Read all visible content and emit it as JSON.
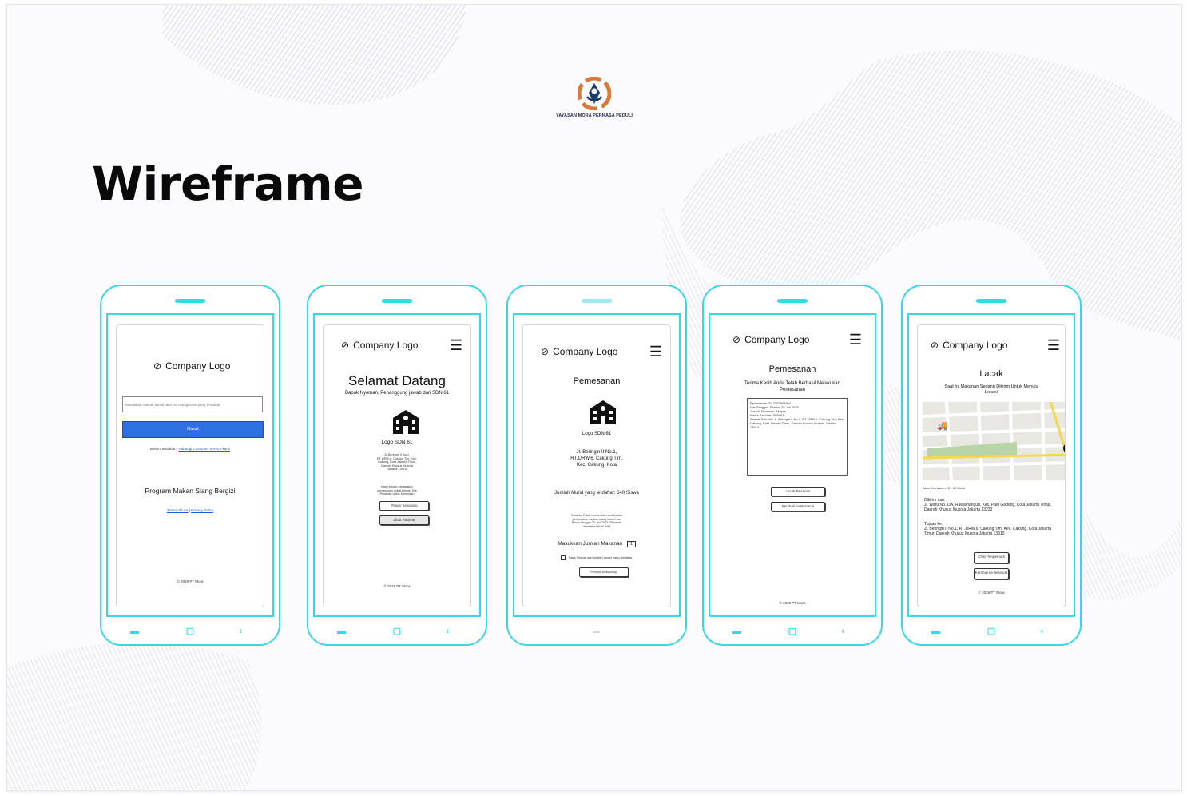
{
  "brand": {
    "name": "YAYASAN MORA PERKASA PEDULI"
  },
  "slide": {
    "title": "Wireframe"
  },
  "accent_color": "#39d6e6",
  "phones": {
    "login": {
      "logo_text": "Company Logo",
      "input_placeholder": "Masukkan Alamat Email atau No Handphone yang terdaftar",
      "submit_label": "Masuk",
      "signup_prompt": "Belum Terdaftar?",
      "signup_link": "Hubungi Customer Service kami",
      "program_title": "Program Makan Siang Bergizi",
      "terms_link": "Terms of Use",
      "separator": "|",
      "privacy_link": "Privacy Policy",
      "footer": "© 2025 PT Mora"
    },
    "welcome": {
      "logo_text": "Company Logo",
      "title": "Selamat Datang",
      "subtitle": "Bapak Nyoman,  Penanggung jawab dari SDN 61",
      "school_label": "Logo SDN 61",
      "address": "Jl. Beringin II No.1, RT.1/RW.6, Cokung Tim, Kec. Cakung, Kota Jakarta Timur, Daerah Khusus Ibukota Jakarta 13910",
      "note": "Kami belum melakukan pemesanan untuk besok. Klik Pesanan untuk Memesan",
      "order_button": "Pesan Sekarang",
      "history_button": "Lihat Riwayat",
      "footer": "© 2025 PT Mora"
    },
    "order": {
      "logo_text": "Company Logo",
      "title": "Pemesanan",
      "school_label": "Logo SDN 61",
      "address": "Jl. Beringin II No.1, RT.1/RW.6, Cakung Tim, Kec. Cakung, Kota",
      "student_count": "Jumlah Murid yang terdaftar: 640 Siswa",
      "note": "Selamat Pakan Anda akan melakukan pemesanan makan siang untuk Hari Besok tanggal 20 Juli 2025. Pesanan akan tiba 09.00 WIB",
      "quantity_label": "Masukkan Jumlah Makanan",
      "quantity_value": "1",
      "checkbox_label": "Saya Sesuai dan jumlah murid yang terdaftar",
      "submit_button": "Pesan Sekarang"
    },
    "confirm": {
      "logo_text": "Company Logo",
      "title": "Pemesanan",
      "message": "Terima Kasih Anda Telah Berhasil Melakukan Pemesanan",
      "details": [
        "Pemesanan ID: 0202504904",
        "Hari/Tanggal: Selasa, 20 Juli 2025",
        "Jumlah Pesanan: 640pcs",
        "Nama Sekolah: SDN 61",
        "Alamat Sekolah: Jl. Beringin II No.1, RT.1/RW.6, Cakung Tim, Kec. Cakung, Kota Jakarta Timur, Daerah Khusus Ibukota Jakarta 13910"
      ],
      "track_button": "Lacak Pesanan",
      "home_button": "Kembali ke Beranda",
      "footer": "© 2025 PT Mora"
    },
    "track": {
      "logo_text": "Company Logo",
      "title": "Lacak",
      "subtitle": "Saat Ini Makanan Sedang Dikirim Untuk Menuju Lokasi",
      "eta": "Akan tiba dalam 20 - 40 Menit",
      "from_label": "Dikirim dari:",
      "from_address": "Jl. Waru No.33A, Rawamangun, Kec. Pulo Gadung, Kota Jakarta Timur, Daerah Khusus Ibukota Jakarta 13220",
      "to_label": "Tujuan ke:",
      "to_address": "Jl. Beringin II No.1, RT.1/RW.6, Cakung Tim, Kec. Cakung, Kota Jakarta Timur, Daerah Khusus Ibukota Jakarta 13910",
      "contact_button": "Chat Pengemudi",
      "home_button": "Kembali ke Beranda",
      "footer": "© 2025 PT Mora"
    }
  }
}
